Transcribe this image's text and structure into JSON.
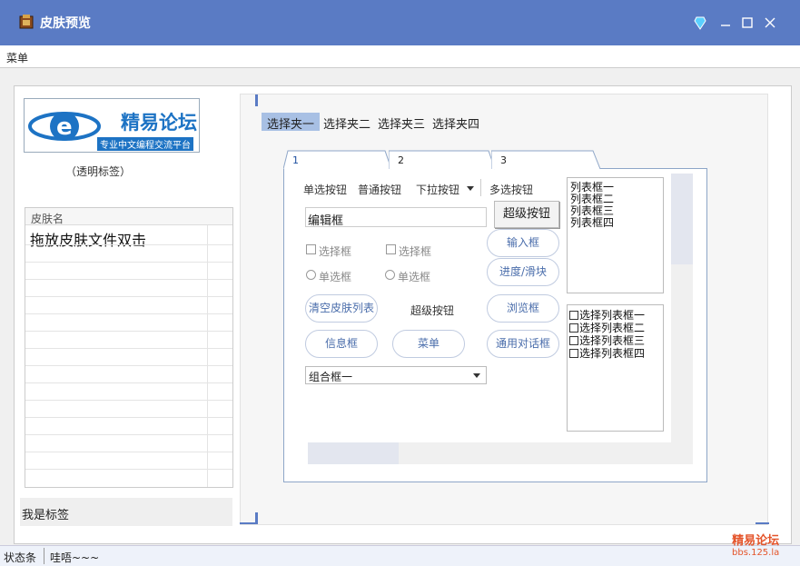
{
  "window": {
    "title": "皮肤预览"
  },
  "menu": {
    "label": "菜单"
  },
  "logo": {
    "name": "精易论坛",
    "slogan": "专业中文编程交流平台"
  },
  "transparent_label": "（透明标签）",
  "skin_list": {
    "header": "皮肤名",
    "hint": "拖放皮肤文件双击"
  },
  "me_label": "我是标签",
  "outer_tabs": [
    "选择夹一",
    "选择夹二",
    "选择夹三",
    "选择夹四"
  ],
  "inner_tabs": [
    "1",
    "2",
    "3"
  ],
  "controls": {
    "radio_button": "单选按钮",
    "normal_button": "普通按钮",
    "dropdown_button": "下拉按钮",
    "multi_button": "多选按钮",
    "edit_value": "编辑框",
    "super_button": "超级按钮",
    "input_box": "输入框",
    "checkbox_1": "选择框",
    "checkbox_2": "选择框",
    "progress": "进度/滑块",
    "radio_1": "单选框",
    "radio_2": "单选框",
    "clear_list": "清空皮肤列表",
    "super_button_label": "超级按钮",
    "browse": "浏览框",
    "info_box": "信息框",
    "menu_button": "菜单",
    "common_dialog": "通用对话框",
    "combo": "组合框一"
  },
  "listbox_items": [
    "列表框一",
    "列表框二",
    "列表框三",
    "列表框四"
  ],
  "checklist_items": [
    "选择列表框一",
    "选择列表框二",
    "选择列表框三",
    "选择列表框四"
  ],
  "status": {
    "left": "状态条",
    "right": "哇唔~~~"
  },
  "watermark": {
    "name": "精易论坛",
    "url": "bbs.125.la"
  },
  "colors": {
    "titlebar": "#5a7bc4",
    "accent": "#1d73c4",
    "watermark": "#e4542a"
  }
}
